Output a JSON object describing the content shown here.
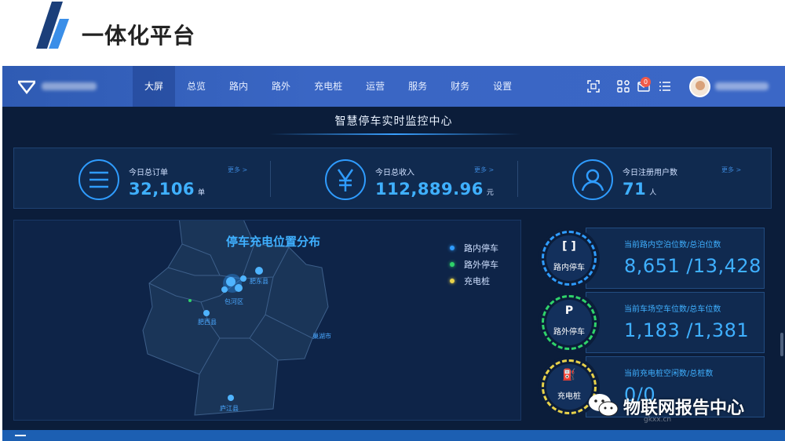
{
  "slide": {
    "title": "一体化平台"
  },
  "nav": {
    "items": [
      "大屏",
      "总览",
      "路内",
      "路外",
      "充电桩",
      "运营",
      "服务",
      "财务",
      "设置"
    ],
    "active": "大屏",
    "notification_count": "0"
  },
  "screen": {
    "title": "智慧停车实时监控中心"
  },
  "stats": [
    {
      "label": "今日总订单",
      "value": "32,106",
      "unit": "单",
      "more": "更多 >",
      "icon": "list-icon"
    },
    {
      "label": "今日总收入",
      "value": "112,889.96",
      "unit": "元",
      "more": "更多 >",
      "icon": "yen-icon"
    },
    {
      "label": "今日注册用户数",
      "value": "71",
      "unit": "人",
      "more": "更多 >",
      "icon": "user-icon"
    }
  ],
  "map": {
    "title": "停车充电位置分布",
    "legend": [
      {
        "label": "路内停车",
        "color": "#2f9cff"
      },
      {
        "label": "路外停车",
        "color": "#2fd36a"
      },
      {
        "label": "充电桩",
        "color": "#e8d24a"
      }
    ],
    "places": [
      "包河区",
      "肥西县",
      "巢湖市",
      "庐江县",
      "肥东县"
    ]
  },
  "panels": [
    {
      "name": "路内停车",
      "icon": "[ ]",
      "label": "当前路内空泊位数/总泊位数",
      "value": "8,651 /13,428",
      "ring_color": "#2f9cff"
    },
    {
      "name": "路外停车",
      "icon": "P",
      "label": "当前车场空车位数/总车位数",
      "value": "1,183 /1,381",
      "ring_color": "#2fd36a"
    },
    {
      "name": "充电桩",
      "icon": "⛽",
      "label": "当前充电桩空闲数/总桩数",
      "value": "0/0",
      "ring_color": "#e8d24a"
    }
  ],
  "watermark": {
    "text": "物联网报告中心",
    "sub": "gkxx.cn"
  }
}
